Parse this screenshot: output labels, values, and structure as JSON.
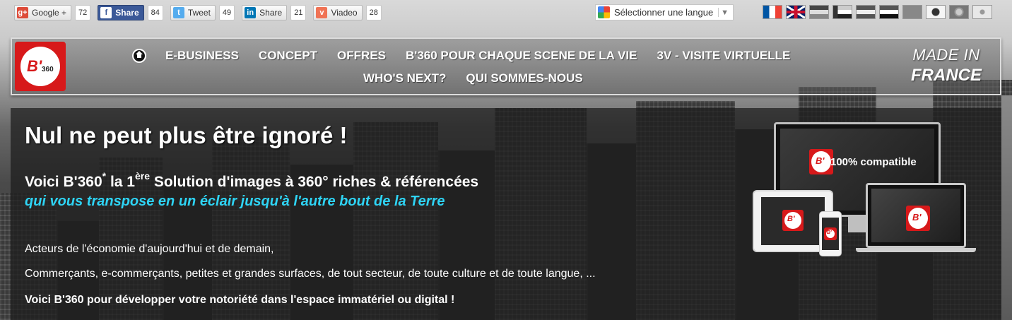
{
  "share_bar": {
    "buttons": [
      {
        "icon": "google-plus-icon",
        "label": "Google +",
        "count": "72",
        "icon_glyph": "g+",
        "icon_color": "#dd4b39"
      },
      {
        "icon": "facebook-icon",
        "label": "Share",
        "count": "84",
        "icon_glyph": "f",
        "icon_color": "#3b5998"
      },
      {
        "icon": "twitter-icon",
        "label": "Tweet",
        "count": "49",
        "icon_glyph": "t",
        "icon_color": "#55acee"
      },
      {
        "icon": "linkedin-icon",
        "label": "Share",
        "count": "21",
        "icon_glyph": "in",
        "icon_color": "#0077b5"
      },
      {
        "icon": "viadeo-icon",
        "label": "Viadeo",
        "count": "28",
        "icon_glyph": "v",
        "icon_color": "#f07355"
      }
    ]
  },
  "language_selector": {
    "label": "Sélectionner une langue",
    "icon": "google-translate-icon"
  },
  "flags": [
    "flag-france-icon",
    "flag-uk-icon",
    "flag-3-icon",
    "flag-4-icon",
    "flag-5-icon",
    "flag-6-icon",
    "flag-7-icon",
    "flag-korea-icon",
    "flag-9-icon",
    "flag-10-icon"
  ],
  "nav": {
    "home_icon": "home-icon",
    "row1": [
      "E-BUSINESS",
      "CONCEPT",
      "OFFRES",
      "B'360 POUR CHAQUE SCENE DE LA VIE",
      "3V - VISITE VIRTUELLE"
    ],
    "row2": [
      "WHO'S NEXT?",
      "QUI SOMMES-NOUS"
    ],
    "made_in_line1": "MADE IN",
    "made_in_line2": "FRANCE"
  },
  "logo": {
    "main": "B'",
    "small": "360"
  },
  "main": {
    "headline": "Nul ne peut plus être ignoré !",
    "subhead_prefix": "Voici B'360",
    "subhead_star": "*",
    "subhead_mid": " la 1",
    "subhead_sup": "ère",
    "subhead_suffix": " Solution d'images à 360° riches & référencées",
    "tagline": "qui vous transpose en un éclair jusqu'à l'autre bout de la Terre",
    "p1": "Acteurs de l'économie d'aujourd'hui et de demain,",
    "p2": "Commerçants, e-commerçants, petites et grandes surfaces, de tout secteur, de toute culture et de toute langue, ...",
    "p3": "Voici B'360 pour développer votre notoriété dans l'espace immatériel ou digital !",
    "devices_label": "100% compatible"
  },
  "colors": {
    "brand_red": "#d7191a",
    "accent_cyan": "#2ed4f5"
  }
}
